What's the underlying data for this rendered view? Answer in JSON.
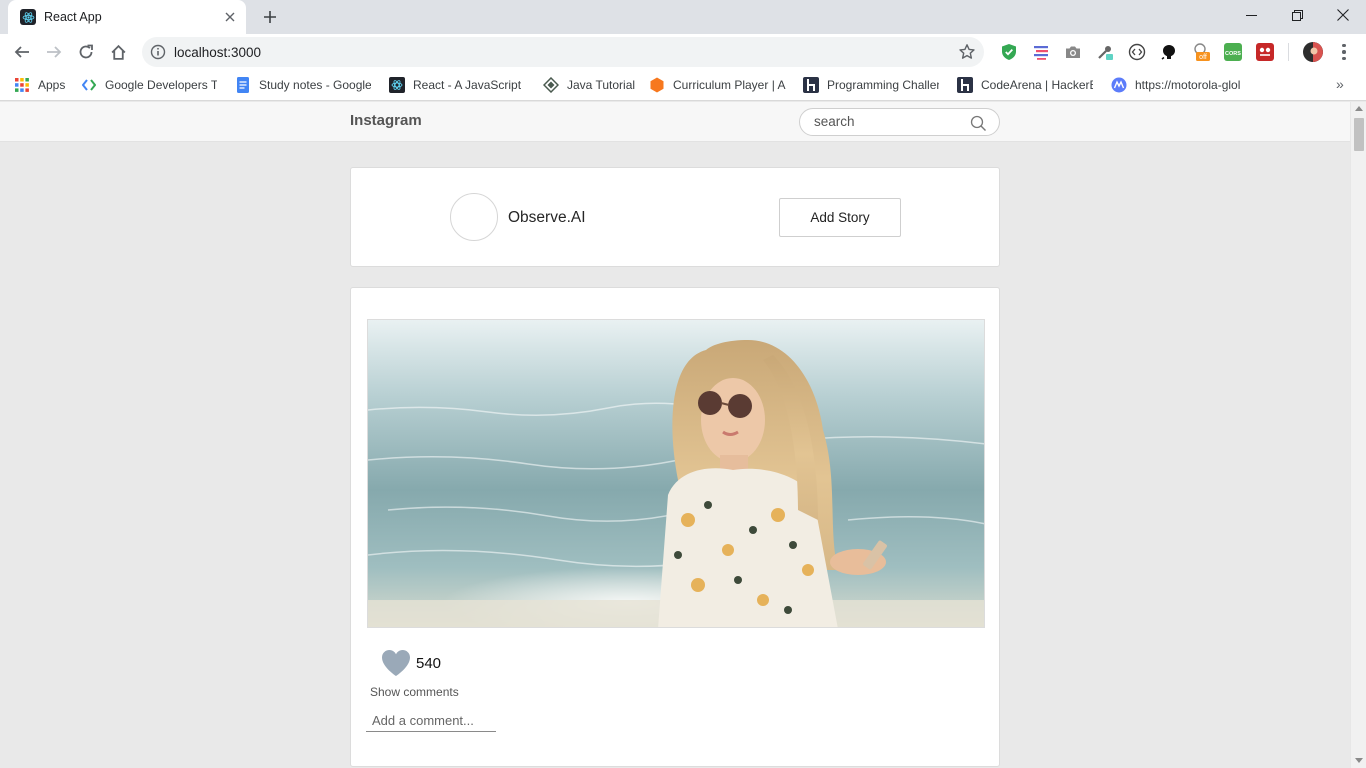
{
  "browser": {
    "tab_title": "React App",
    "url": "localhost:3000",
    "bookmarks": [
      {
        "label": "Apps",
        "icon": "apps-grid-icon"
      },
      {
        "label": "Google Developers Tr",
        "icon": "google-developers-icon"
      },
      {
        "label": "Study notes - Google",
        "icon": "google-docs-icon"
      },
      {
        "label": "React - A JavaScript li",
        "icon": "react-icon"
      },
      {
        "label": "Java Tutorial",
        "icon": "java-tutorial-icon"
      },
      {
        "label": "Curriculum Player | A",
        "icon": "curriculum-icon"
      },
      {
        "label": "Programming Challen",
        "icon": "hackerrank-icon"
      },
      {
        "label": "CodeArena | HackerE",
        "icon": "hackerearth-icon"
      },
      {
        "label": "https://motorola-glol",
        "icon": "motorola-icon"
      }
    ],
    "extensions": [
      "shield-extension-icon",
      "stacks-extension-icon",
      "camera-extension-icon",
      "eyedropper-extension-icon",
      "code-extension-icon",
      "github-extension-icon",
      "off-extension-icon",
      "cors-extension-icon",
      "red-extension-icon",
      "profile-avatar"
    ],
    "extension_off_badge": "off",
    "extension_cors_label": "CORS"
  },
  "app": {
    "brand": "Instagram",
    "search_placeholder": "search"
  },
  "story": {
    "username": "Observe.AI",
    "add_story_label": "Add Story"
  },
  "post": {
    "image_alt": "Woman with sunglasses holding phone at the beach",
    "likes": "540",
    "show_comments_label": "Show comments",
    "comment_placeholder": "Add a comment..."
  },
  "colors": {
    "page_bg": "#e9e9e9",
    "header_bg": "#f7f7f7",
    "heart": "#9aa9b8"
  }
}
